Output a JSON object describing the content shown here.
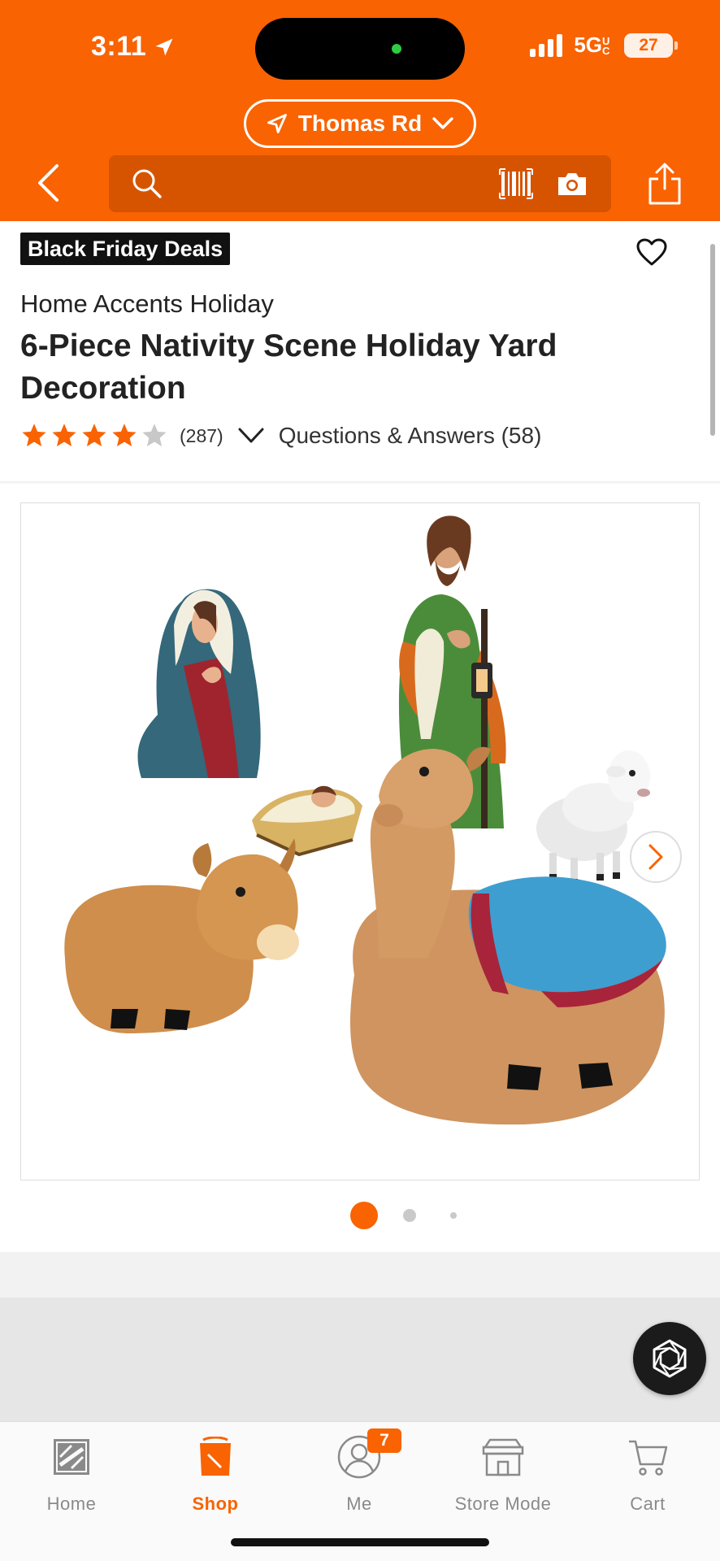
{
  "status_bar": {
    "time": "3:11",
    "network": "5G",
    "network_suffix": "UC",
    "battery": "27"
  },
  "header": {
    "location": "Thomas Rd",
    "search_placeholder": "",
    "colors": {
      "brand": "#f96302",
      "search_bg": "#d65400"
    }
  },
  "product": {
    "badge": "Black Friday Deals",
    "brand": "Home Accents Holiday",
    "title": "6-Piece Nativity Scene Holiday Yard Decoration",
    "rating": 4,
    "rating_max": 5,
    "review_count": "(287)",
    "qa_label": "Questions & Answers (58)"
  },
  "gallery": {
    "image_count": 3,
    "active_index": 0
  },
  "tabs": [
    {
      "label": "Home",
      "icon": "home-depot-logo-icon",
      "active": false
    },
    {
      "label": "Shop",
      "icon": "shop-bucket-icon",
      "active": true
    },
    {
      "label": "Me",
      "icon": "user-icon",
      "active": false,
      "badge": "7"
    },
    {
      "label": "Store Mode",
      "icon": "store-icon",
      "active": false
    },
    {
      "label": "Cart",
      "icon": "cart-icon",
      "active": false
    }
  ]
}
